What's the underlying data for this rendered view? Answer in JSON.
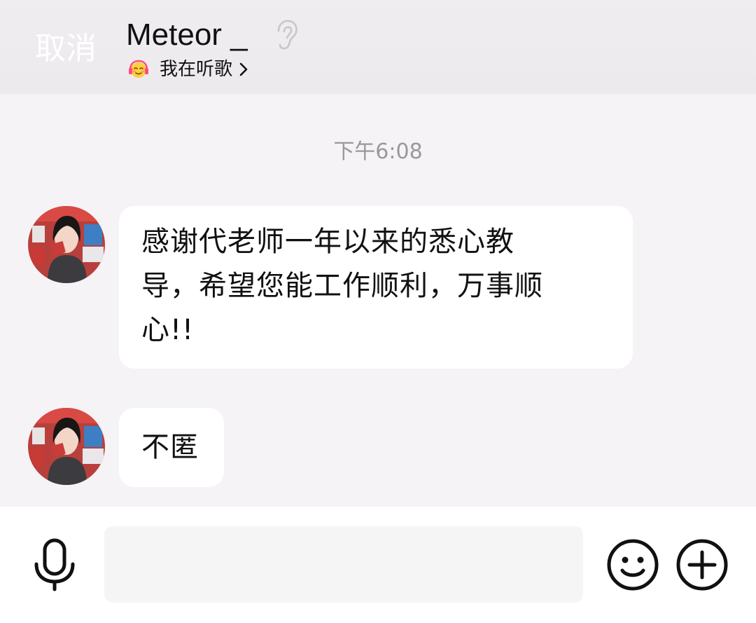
{
  "header": {
    "cancel_label": "取消",
    "contact_name": "Meteor _",
    "status_text": "我在听歌",
    "ear_icon": "ear-icon",
    "status_emoji_icon": "headphones-face-emoji-icon",
    "chevron_icon": "chevron-right-icon"
  },
  "chat": {
    "timestamp": "下午6:08",
    "messages": [
      {
        "sender": "Meteor _",
        "avatar_icon": "avatar",
        "lines": [
          "感谢代老师一年以来的悉心教",
          "导，希望您能工作顺利，万事顺",
          "心!!"
        ]
      },
      {
        "sender": "Meteor _",
        "avatar_icon": "avatar",
        "lines": [
          "不匿"
        ]
      }
    ]
  },
  "input_bar": {
    "mic_icon": "microphone-icon",
    "input_value": "",
    "input_placeholder": "",
    "emoji_icon": "smiley-icon",
    "plus_icon": "plus-circle-icon"
  },
  "colors": {
    "background": "#f5f3f6",
    "header_background": "#eeecef",
    "bubble": "#ffffff",
    "timestamp": "#9a989b",
    "text": "#111111",
    "input_background": "#f5f5f5"
  }
}
